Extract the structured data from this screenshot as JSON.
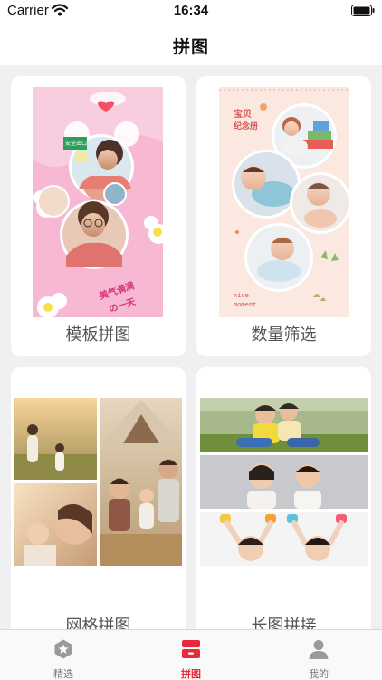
{
  "status_bar": {
    "carrier": "Carrier",
    "time": "16:34"
  },
  "nav": {
    "title": "拼图"
  },
  "cards": [
    {
      "label": "模板拼图",
      "art_text": [
        "安全出口",
        "美气满满",
        "の一天"
      ]
    },
    {
      "label": "数量筛选",
      "art_text": [
        "宝贝",
        "纪念册",
        "nice",
        "moment"
      ]
    },
    {
      "label": "网格拼图"
    },
    {
      "label": "长图拼接"
    }
  ],
  "tabs": [
    {
      "label": "精选",
      "icon": "star-badge-icon",
      "active": false
    },
    {
      "label": "拼图",
      "icon": "collage-icon",
      "active": true
    },
    {
      "label": "我的",
      "icon": "person-icon",
      "active": false
    }
  ],
  "colors": {
    "accent": "#e8293b",
    "inactive": "#777777",
    "background": "#f0f0f2"
  }
}
